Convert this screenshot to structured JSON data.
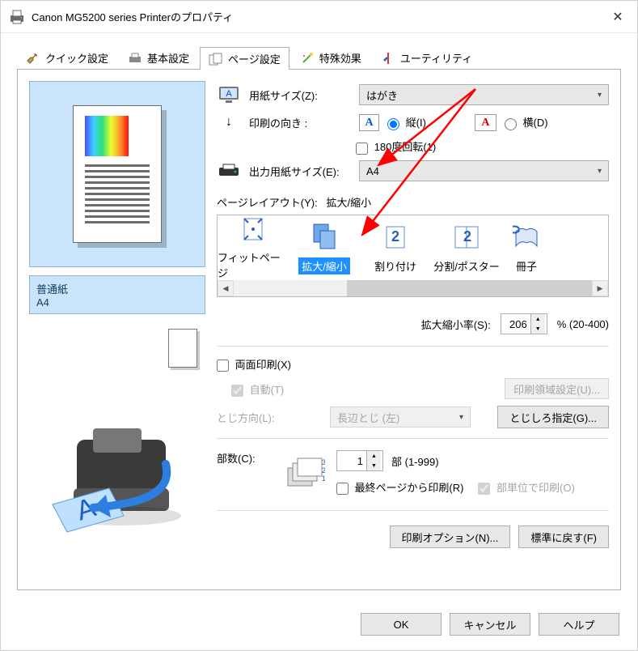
{
  "title": "Canon MG5200 series Printerのプロパティ",
  "tabs": {
    "quick": "クイック設定",
    "basic": "基本設定",
    "page": "ページ設定",
    "effects": "特殊効果",
    "utility": "ユーティリティ"
  },
  "left": {
    "media": "普通紙",
    "paper": "A4"
  },
  "labels": {
    "paper_size": "用紙サイズ(Z):",
    "orientation": "印刷の向き :",
    "orient_v": "縦(I)",
    "orient_h": "横(D)",
    "rotate_180": "180度回転(1)",
    "output_size": "出力用紙サイズ(E):",
    "page_layout": "ページレイアウト(Y):",
    "current_layout": "拡大/縮小",
    "scale_ratio": "拡大縮小率(S):",
    "scale_range": "% (20-400)",
    "duplex": "両面印刷(X)",
    "auto": "自動(T)",
    "print_area_btn": "印刷領域設定(U)...",
    "bind_dir": "とじ方向(L):",
    "bind_val": "長辺とじ (左)",
    "bind_margin_btn": "とじしろ指定(G)...",
    "copies": "部数(C):",
    "copies_range": "部 (1-999)",
    "last_page": "最終ページから印刷(R)",
    "collate": "部単位で印刷(O)",
    "print_options_btn": "印刷オプション(N)...",
    "reset_btn": "標準に戻す(F)"
  },
  "values": {
    "paper_size": "はがき",
    "output_size": "A4",
    "scale": "206",
    "copies": "1"
  },
  "layout_items": {
    "fit": "フィットページ",
    "scale": "拡大/縮小",
    "nup": "割り付け",
    "poster": "分割/ポスター",
    "book": "冊子"
  },
  "footer": {
    "ok": "OK",
    "cancel": "キャンセル",
    "help": "ヘルプ"
  }
}
